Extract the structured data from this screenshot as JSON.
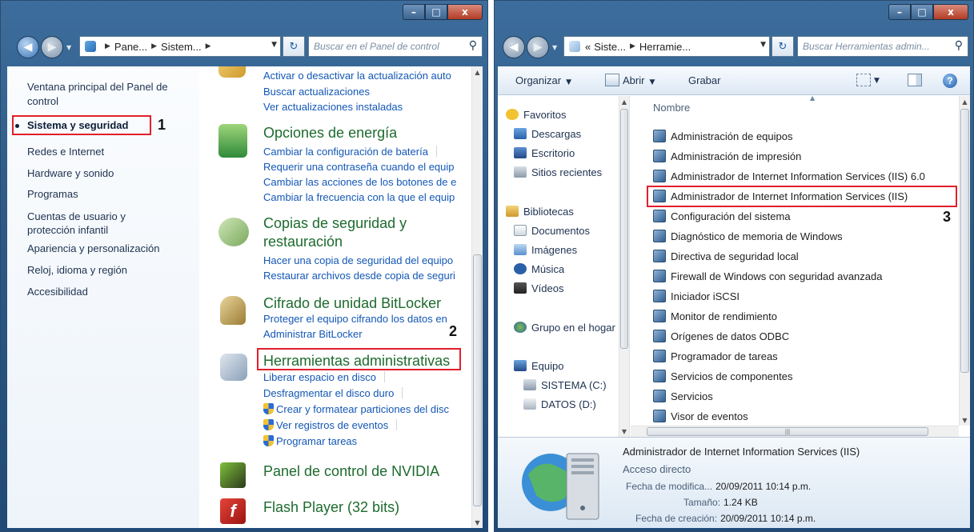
{
  "left_window": {
    "controls": {
      "minimize": "–",
      "maximize": "□",
      "close": "x"
    },
    "address": {
      "crumbs": [
        "Pane...",
        "Sistem..."
      ]
    },
    "search_placeholder": "Buscar en el Panel de control",
    "sidebar": {
      "home": "Ventana principal del Panel de control",
      "categories": [
        "Sistema y seguridad",
        "Redes e Internet",
        "Hardware y sonido",
        "Programas",
        "Cuentas de usuario y protección infantil",
        "Apariencia y personalización",
        "Reloj, idioma y región",
        "Accesibilidad"
      ],
      "step_number": "1"
    },
    "tasks": {
      "update": {
        "links": [
          "Activar o desactivar la actualización auto",
          "Buscar actualizaciones",
          "Ver actualizaciones instaladas"
        ]
      },
      "power": {
        "title": "Opciones de energía",
        "links": [
          "Cambiar la configuración de batería",
          "Requerir una contraseña cuando el equip",
          "Cambiar las acciones de los botones de e",
          "Cambiar la frecuencia con la que el equip"
        ]
      },
      "backup": {
        "title_line1": "Copias de seguridad y",
        "title_line2": "restauración",
        "links": [
          "Hacer una copia de seguridad del equipo",
          "Restaurar archivos desde copia de seguri"
        ]
      },
      "bitlocker": {
        "title": "Cifrado de unidad BitLocker",
        "links": [
          "Proteger el equipo cifrando los datos en",
          "Administrar BitLocker"
        ]
      },
      "admin": {
        "title": "Herramientas administrativas",
        "links": [
          "Liberar espacio en disco",
          "Desfragmentar el disco duro",
          "Crear y formatear particiones del disc",
          "Ver registros de eventos",
          "Programar tareas"
        ],
        "step_number": "2"
      },
      "nvidia": {
        "title": "Panel de control de NVIDIA"
      },
      "flash": {
        "title": "Flash Player (32 bits)"
      }
    }
  },
  "right_window": {
    "controls": {
      "minimize": "–",
      "maximize": "□",
      "close": "x"
    },
    "address": {
      "prefix": "«",
      "crumbs": [
        "Siste...",
        "Herramie..."
      ]
    },
    "search_placeholder": "Buscar Herramientas admin...",
    "toolbar": {
      "organize": "Organizar",
      "open": "Abrir",
      "record": "Grabar"
    },
    "nav_pane": {
      "favorites": "Favoritos",
      "downloads": "Descargas",
      "desktop": "Escritorio",
      "recent": "Sitios recientes",
      "libraries": "Bibliotecas",
      "documents": "Documentos",
      "images": "Imágenes",
      "music": "Música",
      "videos": "Vídeos",
      "homegroup": "Grupo en el hogar",
      "computer": "Equipo",
      "drive_c": "SISTEMA (C:)",
      "drive_d": "DATOS (D:)"
    },
    "files": {
      "column": "Nombre",
      "items": [
        "Administración de equipos",
        "Administración de impresión",
        "Administrador de Internet Information Services (IIS) 6.0",
        "Administrador de Internet Information Services (IIS)",
        "Configuración del sistema",
        "Diagnóstico de memoria de Windows",
        "Directiva de seguridad local",
        "Firewall de Windows con seguridad avanzada",
        "Iniciador iSCSI",
        "Monitor de rendimiento",
        "Orígenes de datos ODBC",
        "Programador de tareas",
        "Servicios de componentes",
        "Servicios",
        "Visor de eventos"
      ],
      "step_number": "3"
    },
    "details": {
      "title": "Administrador de Internet Information Services (IIS)",
      "type": "Acceso directo",
      "modified_label": "Fecha de modifica...",
      "modified_value": "20/09/2011 10:14 p.m.",
      "size_label": "Tamaño:",
      "size_value": "1.24 KB",
      "created_label": "Fecha de creación:",
      "created_value": "20/09/2011 10:14 p.m."
    }
  },
  "colors": {
    "highlight_box": "#e21f2b",
    "link": "#1357b6",
    "task_title": "#1d6b2e"
  }
}
